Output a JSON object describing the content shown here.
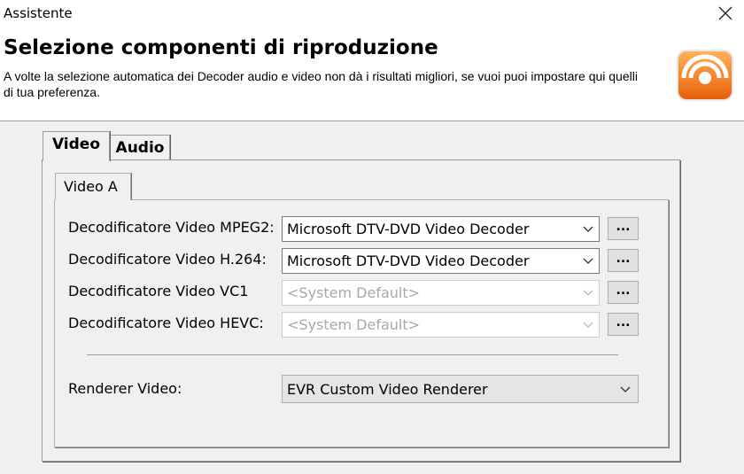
{
  "window": {
    "title": "Assistente"
  },
  "header": {
    "heading": "Selezione componenti di riproduzione",
    "description": "A volte la selezione automatica dei Decoder audio e video non dà i risultati migliori, se vuoi puoi impostare qui quelli di tua preferenza."
  },
  "tabs": [
    {
      "label": "Video",
      "selected": true
    },
    {
      "label": "Audio",
      "selected": false
    }
  ],
  "subtab": {
    "label": "Video A"
  },
  "decoders": [
    {
      "label": "Decodificatore Video MPEG2:",
      "value": "Microsoft DTV-DVD Video Decoder",
      "enabled": true,
      "button": "..."
    },
    {
      "label": "Decodificatore Video H.264:",
      "value": "Microsoft DTV-DVD Video Decoder",
      "enabled": true,
      "button": "..."
    },
    {
      "label": "Decodificatore Video VC1",
      "value": "<System Default>",
      "enabled": false,
      "button": "..."
    },
    {
      "label": "Decodificatore Video HEVC:",
      "value": "<System Default>",
      "enabled": false,
      "button": "..."
    }
  ],
  "renderer": {
    "label": "Renderer Video:",
    "value": "EVR Custom Video Renderer"
  },
  "colors": {
    "accent": "#f07a1a",
    "header_bg": "#ffffff",
    "panel_bg": "#f0f0f0"
  },
  "icons": {
    "close": "close-icon",
    "logo": "player-logo-icon",
    "dropdown": "chevron-down-icon"
  }
}
